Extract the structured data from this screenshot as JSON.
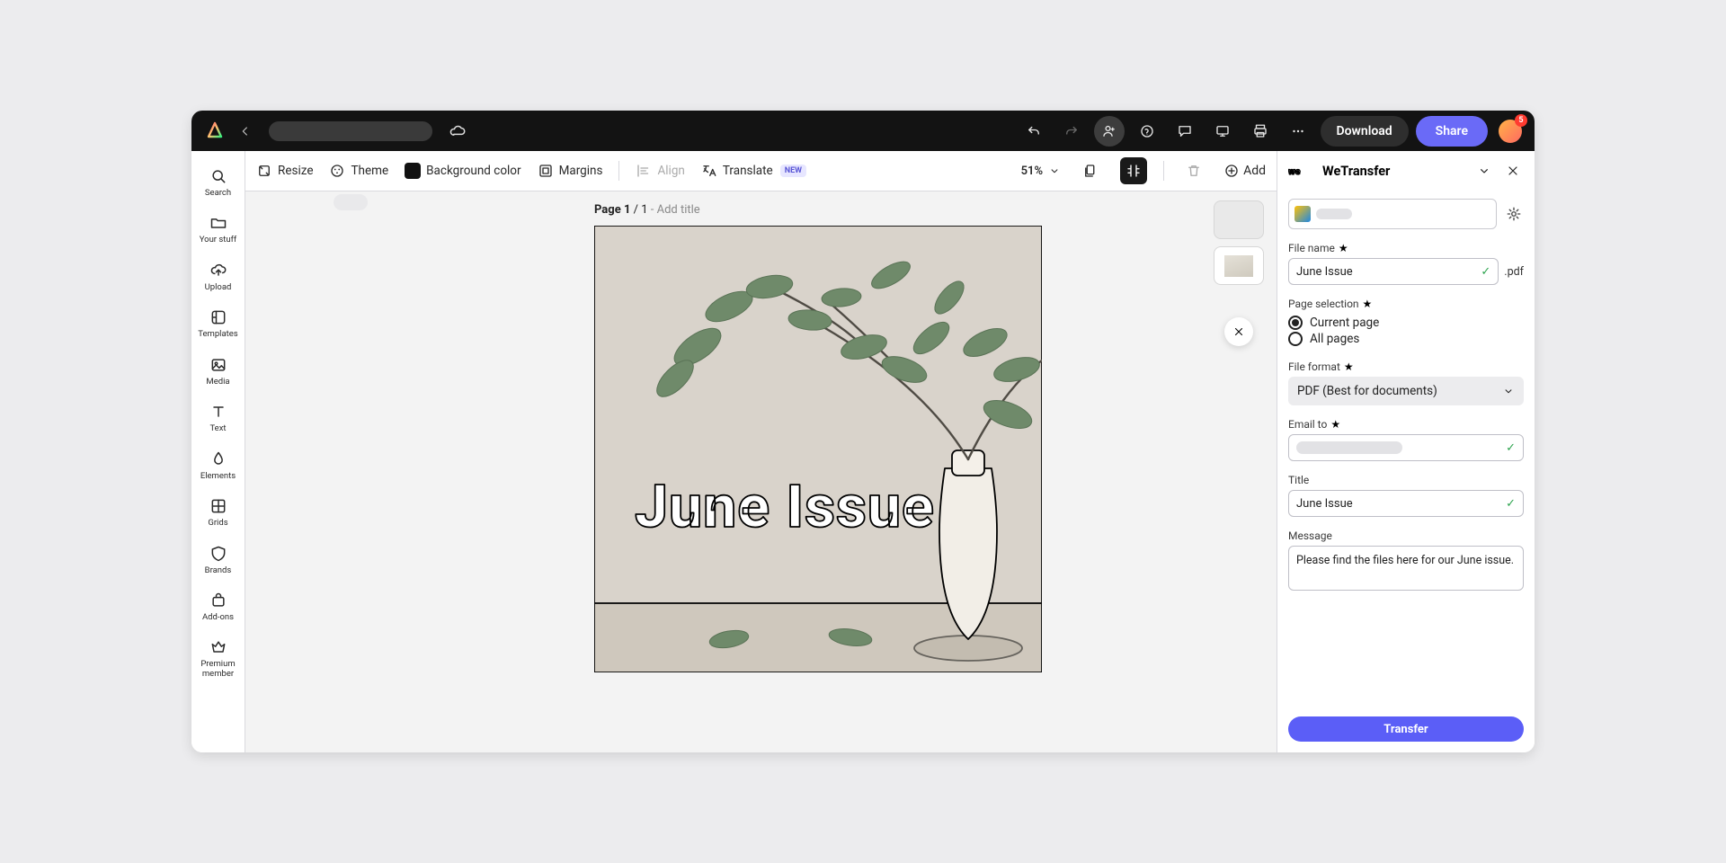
{
  "topbar": {
    "download": "Download",
    "share": "Share",
    "notif_count": "5"
  },
  "leftbar": {
    "items": [
      {
        "label": "Search",
        "icon": "search-icon"
      },
      {
        "label": "Your stuff",
        "icon": "folder-icon"
      },
      {
        "label": "Upload",
        "icon": "upload-icon"
      },
      {
        "label": "Templates",
        "icon": "templates-icon"
      },
      {
        "label": "Media",
        "icon": "media-icon"
      },
      {
        "label": "Text",
        "icon": "text-icon"
      },
      {
        "label": "Elements",
        "icon": "elements-icon"
      },
      {
        "label": "Grids",
        "icon": "grids-icon"
      },
      {
        "label": "Brands",
        "icon": "brands-icon"
      },
      {
        "label": "Add-ons",
        "icon": "addons-icon"
      },
      {
        "label": "Premium member",
        "icon": "premium-icon"
      }
    ]
  },
  "toolbar": {
    "resize": "Resize",
    "theme": "Theme",
    "bgcolor": "Background color",
    "margins": "Margins",
    "align": "Align",
    "translate": "Translate",
    "new_badge": "NEW",
    "zoom": "51%",
    "add": "Add"
  },
  "page": {
    "prefix": "Page ",
    "current": "1",
    "sep": " / ",
    "total": "1",
    "add_title": " - Add title"
  },
  "canvas": {
    "headline": "June Issue"
  },
  "panel": {
    "name": "WeTransfer",
    "file_name_label": "File name",
    "file_name_value": "June Issue",
    "file_ext": ".pdf",
    "page_sel_label": "Page selection",
    "page_sel_current": "Current page",
    "page_sel_all": "All pages",
    "file_format_label": "File format",
    "file_format_value": "PDF (Best for documents)",
    "email_label": "Email to",
    "title_label": "Title",
    "title_value": "June Issue",
    "message_label": "Message",
    "message_value": "Please find the files here for our June issue.",
    "transfer_btn": "Transfer"
  }
}
